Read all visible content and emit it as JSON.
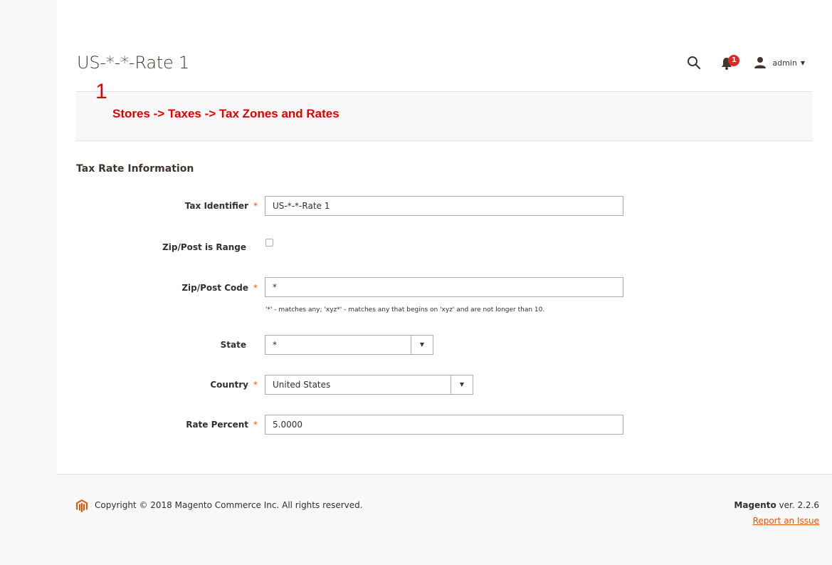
{
  "page": {
    "title": "US-*-*-Rate 1"
  },
  "header": {
    "notification_count": "1",
    "user_label": "admin"
  },
  "annotation": {
    "number": "1",
    "text": "Stores -> Taxes -> Tax Zones and Rates"
  },
  "form": {
    "section_title": "Tax Rate Information",
    "required_mark": "*",
    "tax_identifier": {
      "label": "Tax Identifier",
      "value": "US-*-*-Rate 1"
    },
    "zip_is_range": {
      "label": "Zip/Post is Range",
      "checked": false
    },
    "zip_code": {
      "label": "Zip/Post Code",
      "value": "*",
      "note": "'*' - matches any; 'xyz*' - matches any that begins on 'xyz' and are not longer than 10."
    },
    "state": {
      "label": "State",
      "value": "*"
    },
    "country": {
      "label": "Country",
      "value": "United States"
    },
    "rate_percent": {
      "label": "Rate Percent",
      "value": "5.0000"
    }
  },
  "footer": {
    "copyright": "Copyright © 2018 Magento Commerce Inc. All rights reserved.",
    "brand": "Magento",
    "version": " ver. 2.2.6",
    "report_link": "Report an Issue"
  },
  "colors": {
    "accent": "#eb5202",
    "annotation": "#e00000",
    "badge": "#e22626"
  },
  "icons": [
    "search-icon",
    "bell-icon",
    "user-icon",
    "chevron-down-icon",
    "magento-logo-icon"
  ]
}
